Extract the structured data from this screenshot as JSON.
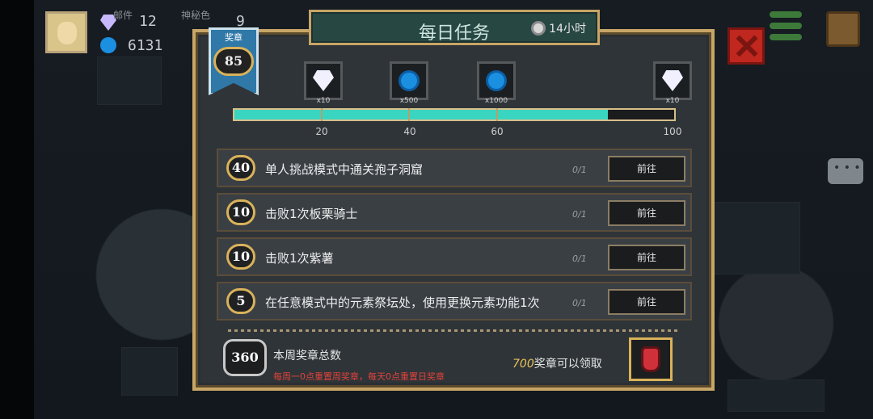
{
  "player": {
    "stat1_label": "邮件",
    "stat1_value": "12",
    "stat2_label": "神秘色",
    "stat2_value": "9",
    "gems": "6131"
  },
  "panel": {
    "title": "每日任务",
    "timer": "14小时",
    "medal_label": "奖章",
    "medal_count": "85"
  },
  "rewards": [
    {
      "icon": "diamond-icon",
      "qty": "x10"
    },
    {
      "icon": "energy-coin-icon",
      "qty": "x500"
    },
    {
      "icon": "energy-coin-icon",
      "qty": "x1000"
    },
    {
      "icon": "diamond-icon",
      "qty": "x10"
    }
  ],
  "progress": {
    "value": 85,
    "max": 100,
    "ticks": [
      "20",
      "40",
      "60",
      "100"
    ]
  },
  "tasks": [
    {
      "points": "40",
      "text": "单人挑战模式中通关孢子洞窟",
      "progress": "0/1",
      "button": "前往"
    },
    {
      "points": "10",
      "text": "击败1次板栗骑士",
      "progress": "0/1",
      "button": "前往"
    },
    {
      "points": "10",
      "text": "击败1次紫薯",
      "progress": "0/1",
      "button": "前往"
    },
    {
      "points": "5",
      "text": "在任意模式中的元素祭坛处，使用更换元素功能1次",
      "progress": "0/1",
      "button": "前往"
    }
  ],
  "weekly": {
    "total": "360",
    "title": "本周奖章总数",
    "note": "每周一0点重置周奖章，每天0点重置日奖章",
    "goal_num": "700",
    "goal_text": "奖章可以领取"
  }
}
